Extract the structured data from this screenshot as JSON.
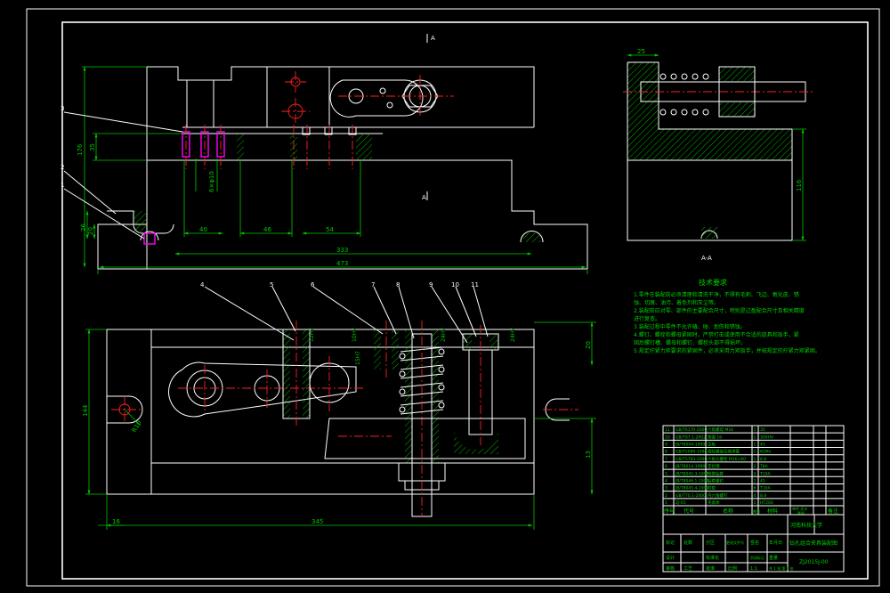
{
  "drawing": {
    "colors": {
      "background": "#000000",
      "outline": "#ffffff",
      "dimension": "#00c800",
      "centerline": "#ff2020",
      "hidden": "#ff00ff",
      "hatch": "#00c800",
      "text": "#00d000"
    },
    "view_marks": {
      "top_section": "A",
      "mid_section": "A",
      "side_view_label": "A-A"
    },
    "front_view": {
      "dimensions": {
        "overall_width": "473",
        "inner_width": "333",
        "seg_1": "40",
        "seg_2": "46",
        "seg_3": "54",
        "height_left": "176",
        "height_a": "35",
        "height_b": "26",
        "height_c": "20",
        "bolt_note": "6×φ10"
      },
      "balloons": [
        "3",
        "2",
        "1"
      ]
    },
    "side_view": {
      "dimensions": {
        "top_width": "25",
        "height": "116"
      }
    },
    "plan_view": {
      "dimensions": {
        "overall_width": "345",
        "left_offset": "16",
        "height_left": "144",
        "height_right": "13",
        "height_top": "20",
        "bolt_circle": "R10",
        "fit_1": "12H7",
        "fit_2": "10H7",
        "fit_3": "15H7",
        "fit_4": "24H7",
        "fit_5": "24H7"
      },
      "balloons": [
        "4",
        "5",
        "6",
        "7",
        "8",
        "9",
        "10",
        "11"
      ]
    },
    "tech_requirements": {
      "title": "技术要求",
      "lines": [
        "1.零件在装配前必须清理和清洗干净，不得有毛刺、飞边、氧化皮、锈",
        "蚀、切屑、油污、着色剂和灰尘等。",
        "2.装配前应对零、部件的主要配合尺寸，特别是过盈配合尺寸及相关精度",
        "进行复查。",
        "3.装配过程中零件不允许磕、碰、划伤和锈蚀。",
        "4.螺钉、螺栓和螺母紧固时，严禁打击或使用不合适的旋具和扳手，紧",
        "固后螺钉槽、螺母和螺钉、螺栓头部不得损坏。",
        "5.规定拧紧力矩要求的紧固件，必须采用力矩扳手，并按规定的拧紧力矩紧固。"
      ]
    },
    "parts_list": {
      "rows": [
        {
          "no": "11",
          "code": "GB/T6170-2000",
          "name": "六角螺母 M16",
          "qty": "1",
          "material": "35"
        },
        {
          "no": "10",
          "code": "GB/T97.1-2002",
          "name": "垫圈 16",
          "qty": "1",
          "material": "300HV"
        },
        {
          "no": "9",
          "code": "JB/T8004-1999",
          "name": "压板",
          "qty": "1",
          "material": "45"
        },
        {
          "no": "8",
          "code": "GB/T2089-1994",
          "name": "圆柱螺旋压缩弹簧",
          "qty": "1",
          "material": "65Mn"
        },
        {
          "no": "7",
          "code": "GB/T5783-2000",
          "name": "六角头螺栓 M16×60",
          "qty": "1",
          "material": "8.8"
        },
        {
          "no": "6",
          "code": "JB/T8014-1999",
          "name": "定位销",
          "qty": "2",
          "material": "T8A"
        },
        {
          "no": "5",
          "code": "JB/T8045.3-1999",
          "name": "快换钻套",
          "qty": "2",
          "material": "T10A"
        },
        {
          "no": "4",
          "code": "JB/T8046.1-1999",
          "name": "钻套螺钉",
          "qty": "2",
          "material": "45"
        },
        {
          "no": "3",
          "code": "JB/T8045.4-1999",
          "name": "衬套",
          "qty": "6",
          "material": "T10A"
        },
        {
          "no": "2",
          "code": "GB/T70.1-2000",
          "name": "内六角螺钉",
          "qty": "4",
          "material": "8.8"
        },
        {
          "no": "1",
          "code": "ZJ-01",
          "name": "夹具体",
          "qty": "1",
          "material": "HT200"
        }
      ],
      "header": {
        "no": "序号",
        "code": "代号",
        "name": "名称",
        "qty": "数量",
        "material": "材料",
        "weight": "单件 总计",
        "weight2": "重量",
        "remark": "备注"
      }
    },
    "title_block": {
      "school": "河南科技大学",
      "drawing_name": "钻孔组合夹具装配图",
      "drawing_no": "ZJ2015J-00",
      "scale_label": "比例",
      "scale": "1:1",
      "sheet": "共 1 张  第 1 张",
      "mark": "标记",
      "count": "处数",
      "zone": "分区",
      "change": "更改文件号",
      "sign": "签名",
      "date": "年月日",
      "design": "设计",
      "standardize": "标准化",
      "stage": "阶段标记",
      "weight": "重量",
      "review": "审核",
      "process": "工艺",
      "approve": "批准"
    }
  }
}
